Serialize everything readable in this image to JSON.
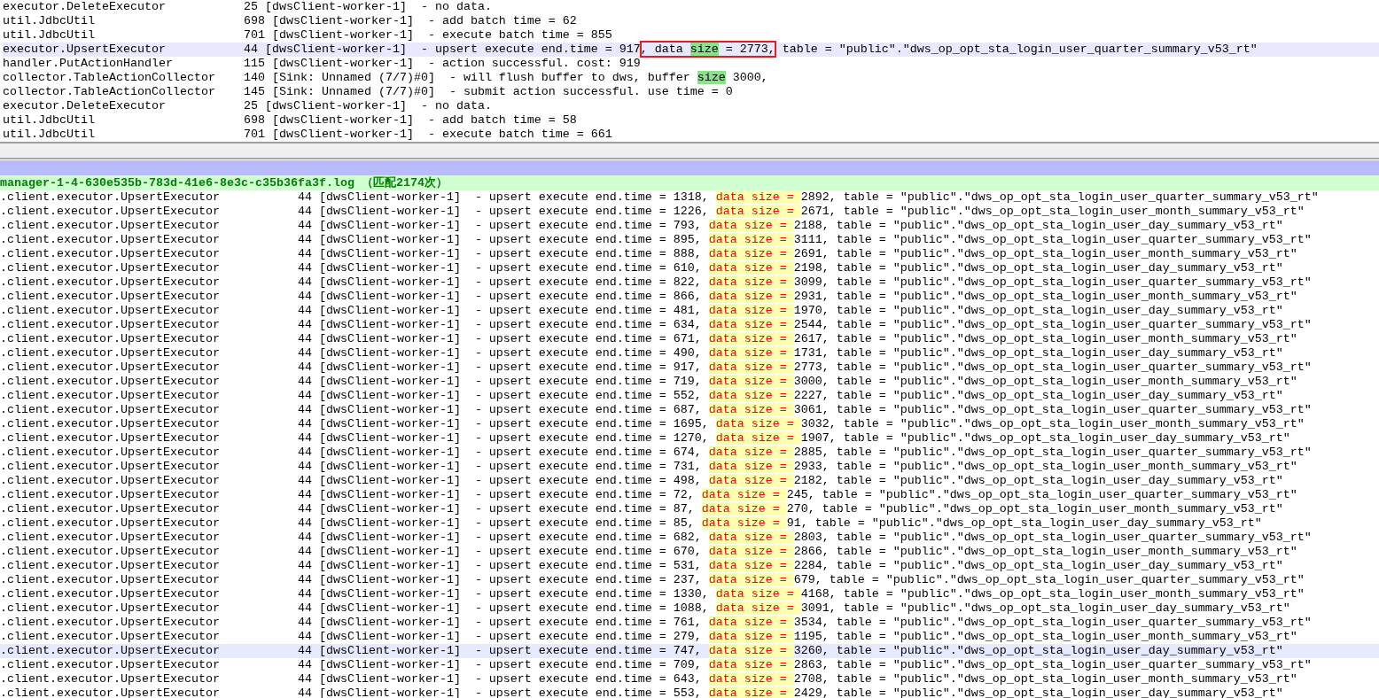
{
  "top_pane": {
    "lines": [
      {
        "current": false,
        "parts": [
          {
            "kind": "plain",
            "boxed": false,
            "text": "executor.DeleteExecutor           25 [dwsClient-worker-1]  - no data."
          }
        ]
      },
      {
        "current": false,
        "parts": [
          {
            "kind": "plain",
            "boxed": false,
            "text": "util.JdbcUtil                     698 [dwsClient-worker-1]  - add batch time = 62"
          }
        ]
      },
      {
        "current": false,
        "parts": [
          {
            "kind": "plain",
            "boxed": false,
            "text": "util.JdbcUtil                     701 [dwsClient-worker-1]  - execute batch time = 855"
          }
        ]
      },
      {
        "current": true,
        "parts": [
          {
            "kind": "plain",
            "boxed": false,
            "text": "executor.UpsertExecutor           44 [dwsClient-worker-1]  - upsert execute end.time = 917"
          },
          {
            "kind": "plain",
            "boxed": true,
            "text": ", data "
          },
          {
            "kind": "match",
            "boxed": true,
            "text": "size"
          },
          {
            "kind": "plain",
            "boxed": true,
            "text": " = 2773,"
          },
          {
            "kind": "plain",
            "boxed": false,
            "text": " table = \"public\".\"dws_op_opt_sta_login_user_quarter_summary_v53_rt\""
          }
        ]
      },
      {
        "current": false,
        "parts": [
          {
            "kind": "plain",
            "boxed": false,
            "text": "handler.PutActionHandler          115 [dwsClient-worker-1]  - action successful. cost: 919"
          }
        ]
      },
      {
        "current": false,
        "parts": [
          {
            "kind": "plain",
            "boxed": false,
            "text": "collector.TableActionCollector    140 [Sink: Unnamed (7/7)#0]  - will flush buffer to dws, buffer "
          },
          {
            "kind": "match",
            "boxed": false,
            "text": "size"
          },
          {
            "kind": "plain",
            "boxed": false,
            "text": " 3000,"
          }
        ]
      },
      {
        "current": false,
        "parts": [
          {
            "kind": "plain",
            "boxed": false,
            "text": "collector.TableActionCollector    145 [Sink: Unnamed (7/7)#0]  - submit action successful. use time = 0"
          }
        ]
      },
      {
        "current": false,
        "parts": [
          {
            "kind": "plain",
            "boxed": false,
            "text": "executor.DeleteExecutor           25 [dwsClient-worker-1]  - no data."
          }
        ]
      },
      {
        "current": false,
        "parts": [
          {
            "kind": "plain",
            "boxed": false,
            "text": "util.JdbcUtil                     698 [dwsClient-worker-1]  - add batch time = 58"
          }
        ]
      },
      {
        "current": false,
        "parts": [
          {
            "kind": "plain",
            "boxed": false,
            "text": "util.JdbcUtil                     701 [dwsClient-worker-1]  - execute batch time = 661"
          }
        ]
      }
    ]
  },
  "search_results": {
    "file_header": "manager-1-4-630e535b-783d-41e6-8e3c-c35b36fa3f.log （匹配2174次）",
    "lines": [
      {
        "current": false,
        "parts": [
          {
            "kind": "plain",
            "text": ".client.executor.UpsertExecutor           44 [dwsClient-worker-1]  - upsert execute end.time = 1318, "
          },
          {
            "kind": "hit",
            "text": "data size = "
          },
          {
            "kind": "plain",
            "text": "2892, table = \"public\".\"dws_op_opt_sta_login_user_quarter_summary_v53_rt\""
          }
        ]
      },
      {
        "current": false,
        "parts": [
          {
            "kind": "plain",
            "text": ".client.executor.UpsertExecutor           44 [dwsClient-worker-1]  - upsert execute end.time = 1226, "
          },
          {
            "kind": "hit",
            "text": "data size = "
          },
          {
            "kind": "plain",
            "text": "2671, table = \"public\".\"dws_op_opt_sta_login_user_month_summary_v53_rt\""
          }
        ]
      },
      {
        "current": false,
        "parts": [
          {
            "kind": "plain",
            "text": ".client.executor.UpsertExecutor           44 [dwsClient-worker-1]  - upsert execute end.time = 793, "
          },
          {
            "kind": "hit",
            "text": "data size = "
          },
          {
            "kind": "plain",
            "text": "2188, table = \"public\".\"dws_op_opt_sta_login_user_day_summary_v53_rt\""
          }
        ]
      },
      {
        "current": false,
        "parts": [
          {
            "kind": "plain",
            "text": ".client.executor.UpsertExecutor           44 [dwsClient-worker-1]  - upsert execute end.time = 895, "
          },
          {
            "kind": "hit",
            "text": "data size = "
          },
          {
            "kind": "plain",
            "text": "3111, table = \"public\".\"dws_op_opt_sta_login_user_quarter_summary_v53_rt\""
          }
        ]
      },
      {
        "current": false,
        "parts": [
          {
            "kind": "plain",
            "text": ".client.executor.UpsertExecutor           44 [dwsClient-worker-1]  - upsert execute end.time = 888, "
          },
          {
            "kind": "hit",
            "text": "data size = "
          },
          {
            "kind": "plain",
            "text": "2691, table = \"public\".\"dws_op_opt_sta_login_user_month_summary_v53_rt\""
          }
        ]
      },
      {
        "current": false,
        "parts": [
          {
            "kind": "plain",
            "text": ".client.executor.UpsertExecutor           44 [dwsClient-worker-1]  - upsert execute end.time = 610, "
          },
          {
            "kind": "hit",
            "text": "data size = "
          },
          {
            "kind": "plain",
            "text": "2198, table = \"public\".\"dws_op_opt_sta_login_user_day_summary_v53_rt\""
          }
        ]
      },
      {
        "current": false,
        "parts": [
          {
            "kind": "plain",
            "text": ".client.executor.UpsertExecutor           44 [dwsClient-worker-1]  - upsert execute end.time = 822, "
          },
          {
            "kind": "hit",
            "text": "data size = "
          },
          {
            "kind": "plain",
            "text": "3099, table = \"public\".\"dws_op_opt_sta_login_user_quarter_summary_v53_rt\""
          }
        ]
      },
      {
        "current": false,
        "parts": [
          {
            "kind": "plain",
            "text": ".client.executor.UpsertExecutor           44 [dwsClient-worker-1]  - upsert execute end.time = 866, "
          },
          {
            "kind": "hit",
            "text": "data size = "
          },
          {
            "kind": "plain",
            "text": "2931, table = \"public\".\"dws_op_opt_sta_login_user_month_summary_v53_rt\""
          }
        ]
      },
      {
        "current": false,
        "parts": [
          {
            "kind": "plain",
            "text": ".client.executor.UpsertExecutor           44 [dwsClient-worker-1]  - upsert execute end.time = 481, "
          },
          {
            "kind": "hit",
            "text": "data size = "
          },
          {
            "kind": "plain",
            "text": "1970, table = \"public\".\"dws_op_opt_sta_login_user_day_summary_v53_rt\""
          }
        ]
      },
      {
        "current": false,
        "parts": [
          {
            "kind": "plain",
            "text": ".client.executor.UpsertExecutor           44 [dwsClient-worker-1]  - upsert execute end.time = 634, "
          },
          {
            "kind": "hit",
            "text": "data size = "
          },
          {
            "kind": "plain",
            "text": "2544, table = \"public\".\"dws_op_opt_sta_login_user_quarter_summary_v53_rt\""
          }
        ]
      },
      {
        "current": false,
        "parts": [
          {
            "kind": "plain",
            "text": ".client.executor.UpsertExecutor           44 [dwsClient-worker-1]  - upsert execute end.time = 671, "
          },
          {
            "kind": "hit",
            "text": "data size = "
          },
          {
            "kind": "plain",
            "text": "2617, table = \"public\".\"dws_op_opt_sta_login_user_month_summary_v53_rt\""
          }
        ]
      },
      {
        "current": false,
        "parts": [
          {
            "kind": "plain",
            "text": ".client.executor.UpsertExecutor           44 [dwsClient-worker-1]  - upsert execute end.time = 490, "
          },
          {
            "kind": "hit",
            "text": "data size = "
          },
          {
            "kind": "plain",
            "text": "1731, table = \"public\".\"dws_op_opt_sta_login_user_day_summary_v53_rt\""
          }
        ]
      },
      {
        "current": false,
        "parts": [
          {
            "kind": "plain",
            "text": ".client.executor.UpsertExecutor           44 [dwsClient-worker-1]  - upsert execute end.time = 917, "
          },
          {
            "kind": "hit",
            "text": "data size = "
          },
          {
            "kind": "plain",
            "text": "2773, table = \"public\".\"dws_op_opt_sta_login_user_quarter_summary_v53_rt\""
          }
        ]
      },
      {
        "current": false,
        "parts": [
          {
            "kind": "plain",
            "text": ".client.executor.UpsertExecutor           44 [dwsClient-worker-1]  - upsert execute end.time = 719, "
          },
          {
            "kind": "hit",
            "text": "data size = "
          },
          {
            "kind": "plain",
            "text": "3000, table = \"public\".\"dws_op_opt_sta_login_user_month_summary_v53_rt\""
          }
        ]
      },
      {
        "current": false,
        "parts": [
          {
            "kind": "plain",
            "text": ".client.executor.UpsertExecutor           44 [dwsClient-worker-1]  - upsert execute end.time = 552, "
          },
          {
            "kind": "hit",
            "text": "data size = "
          },
          {
            "kind": "plain",
            "text": "2227, table = \"public\".\"dws_op_opt_sta_login_user_day_summary_v53_rt\""
          }
        ]
      },
      {
        "current": false,
        "parts": [
          {
            "kind": "plain",
            "text": ".client.executor.UpsertExecutor           44 [dwsClient-worker-1]  - upsert execute end.time = 687, "
          },
          {
            "kind": "hit",
            "text": "data size = "
          },
          {
            "kind": "plain",
            "text": "3061, table = \"public\".\"dws_op_opt_sta_login_user_quarter_summary_v53_rt\""
          }
        ]
      },
      {
        "current": false,
        "parts": [
          {
            "kind": "plain",
            "text": ".client.executor.UpsertExecutor           44 [dwsClient-worker-1]  - upsert execute end.time = 1695, "
          },
          {
            "kind": "hit",
            "text": "data size = "
          },
          {
            "kind": "plain",
            "text": "3032, table = \"public\".\"dws_op_opt_sta_login_user_month_summary_v53_rt\""
          }
        ]
      },
      {
        "current": false,
        "parts": [
          {
            "kind": "plain",
            "text": ".client.executor.UpsertExecutor           44 [dwsClient-worker-1]  - upsert execute end.time = 1270, "
          },
          {
            "kind": "hit",
            "text": "data size = "
          },
          {
            "kind": "plain",
            "text": "1907, table = \"public\".\"dws_op_opt_sta_login_user_day_summary_v53_rt\""
          }
        ]
      },
      {
        "current": false,
        "parts": [
          {
            "kind": "plain",
            "text": ".client.executor.UpsertExecutor           44 [dwsClient-worker-1]  - upsert execute end.time = 674, "
          },
          {
            "kind": "hit",
            "text": "data size = "
          },
          {
            "kind": "plain",
            "text": "2885, table = \"public\".\"dws_op_opt_sta_login_user_quarter_summary_v53_rt\""
          }
        ]
      },
      {
        "current": false,
        "parts": [
          {
            "kind": "plain",
            "text": ".client.executor.UpsertExecutor           44 [dwsClient-worker-1]  - upsert execute end.time = 731, "
          },
          {
            "kind": "hit",
            "text": "data size = "
          },
          {
            "kind": "plain",
            "text": "2933, table = \"public\".\"dws_op_opt_sta_login_user_month_summary_v53_rt\""
          }
        ]
      },
      {
        "current": false,
        "parts": [
          {
            "kind": "plain",
            "text": ".client.executor.UpsertExecutor           44 [dwsClient-worker-1]  - upsert execute end.time = 498, "
          },
          {
            "kind": "hit",
            "text": "data size = "
          },
          {
            "kind": "plain",
            "text": "2182, table = \"public\".\"dws_op_opt_sta_login_user_day_summary_v53_rt\""
          }
        ]
      },
      {
        "current": false,
        "parts": [
          {
            "kind": "plain",
            "text": ".client.executor.UpsertExecutor           44 [dwsClient-worker-1]  - upsert execute end.time = 72, "
          },
          {
            "kind": "hit",
            "text": "data size = "
          },
          {
            "kind": "plain",
            "text": "245, table = \"public\".\"dws_op_opt_sta_login_user_quarter_summary_v53_rt\""
          }
        ]
      },
      {
        "current": false,
        "parts": [
          {
            "kind": "plain",
            "text": ".client.executor.UpsertExecutor           44 [dwsClient-worker-1]  - upsert execute end.time = 87, "
          },
          {
            "kind": "hit",
            "text": "data size = "
          },
          {
            "kind": "plain",
            "text": "270, table = \"public\".\"dws_op_opt_sta_login_user_month_summary_v53_rt\""
          }
        ]
      },
      {
        "current": false,
        "parts": [
          {
            "kind": "plain",
            "text": ".client.executor.UpsertExecutor           44 [dwsClient-worker-1]  - upsert execute end.time = 85, "
          },
          {
            "kind": "hit",
            "text": "data size = "
          },
          {
            "kind": "plain",
            "text": "91, table = \"public\".\"dws_op_opt_sta_login_user_day_summary_v53_rt\""
          }
        ]
      },
      {
        "current": false,
        "parts": [
          {
            "kind": "plain",
            "text": ".client.executor.UpsertExecutor           44 [dwsClient-worker-1]  - upsert execute end.time = 682, "
          },
          {
            "kind": "hit",
            "text": "data size = "
          },
          {
            "kind": "plain",
            "text": "2803, table = \"public\".\"dws_op_opt_sta_login_user_quarter_summary_v53_rt\""
          }
        ]
      },
      {
        "current": false,
        "parts": [
          {
            "kind": "plain",
            "text": ".client.executor.UpsertExecutor           44 [dwsClient-worker-1]  - upsert execute end.time = 670, "
          },
          {
            "kind": "hit",
            "text": "data size = "
          },
          {
            "kind": "plain",
            "text": "2866, table = \"public\".\"dws_op_opt_sta_login_user_month_summary_v53_rt\""
          }
        ]
      },
      {
        "current": false,
        "parts": [
          {
            "kind": "plain",
            "text": ".client.executor.UpsertExecutor           44 [dwsClient-worker-1]  - upsert execute end.time = 531, "
          },
          {
            "kind": "hit",
            "text": "data size = "
          },
          {
            "kind": "plain",
            "text": "2284, table = \"public\".\"dws_op_opt_sta_login_user_day_summary_v53_rt\""
          }
        ]
      },
      {
        "current": false,
        "parts": [
          {
            "kind": "plain",
            "text": ".client.executor.UpsertExecutor           44 [dwsClient-worker-1]  - upsert execute end.time = 237, "
          },
          {
            "kind": "hit",
            "text": "data size = "
          },
          {
            "kind": "plain",
            "text": "679, table = \"public\".\"dws_op_opt_sta_login_user_quarter_summary_v53_rt\""
          }
        ]
      },
      {
        "current": false,
        "parts": [
          {
            "kind": "plain",
            "text": ".client.executor.UpsertExecutor           44 [dwsClient-worker-1]  - upsert execute end.time = 1330, "
          },
          {
            "kind": "hit",
            "text": "data size = "
          },
          {
            "kind": "plain",
            "text": "4168, table = \"public\".\"dws_op_opt_sta_login_user_month_summary_v53_rt\""
          }
        ]
      },
      {
        "current": false,
        "parts": [
          {
            "kind": "plain",
            "text": ".client.executor.UpsertExecutor           44 [dwsClient-worker-1]  - upsert execute end.time = 1088, "
          },
          {
            "kind": "hit",
            "text": "data size = "
          },
          {
            "kind": "plain",
            "text": "3091, table = \"public\".\"dws_op_opt_sta_login_user_day_summary_v53_rt\""
          }
        ]
      },
      {
        "current": false,
        "parts": [
          {
            "kind": "plain",
            "text": ".client.executor.UpsertExecutor           44 [dwsClient-worker-1]  - upsert execute end.time = 761, "
          },
          {
            "kind": "hit",
            "text": "data size = "
          },
          {
            "kind": "plain",
            "text": "3534, table = \"public\".\"dws_op_opt_sta_login_user_quarter_summary_v53_rt\""
          }
        ]
      },
      {
        "current": false,
        "parts": [
          {
            "kind": "plain",
            "text": ".client.executor.UpsertExecutor           44 [dwsClient-worker-1]  - upsert execute end.time = 279, "
          },
          {
            "kind": "hit",
            "text": "data size = "
          },
          {
            "kind": "plain",
            "text": "1195, table = \"public\".\"dws_op_opt_sta_login_user_month_summary_v53_rt\""
          }
        ]
      },
      {
        "current": true,
        "parts": [
          {
            "kind": "plain",
            "text": ".client.executor.UpsertExecutor           44 [dwsClient-worker-1]  - upsert execute end.time = 747, "
          },
          {
            "kind": "hit",
            "text": "data size = "
          },
          {
            "kind": "plain",
            "text": "3260, table = \"public\".\"dws_op_opt_sta_login_user_day_summary_v53_rt\""
          }
        ]
      },
      {
        "current": false,
        "parts": [
          {
            "kind": "plain",
            "text": ".client.executor.UpsertExecutor           44 [dwsClient-worker-1]  - upsert execute end.time = 709, "
          },
          {
            "kind": "hit",
            "text": "data size = "
          },
          {
            "kind": "plain",
            "text": "2863, table = \"public\".\"dws_op_opt_sta_login_user_quarter_summary_v53_rt\""
          }
        ]
      },
      {
        "current": false,
        "parts": [
          {
            "kind": "plain",
            "text": ".client.executor.UpsertExecutor           44 [dwsClient-worker-1]  - upsert execute end.time = 643, "
          },
          {
            "kind": "hit",
            "text": "data size = "
          },
          {
            "kind": "plain",
            "text": "2708, table = \"public\".\"dws_op_opt_sta_login_user_month_summary_v53_rt\""
          }
        ]
      },
      {
        "current": false,
        "parts": [
          {
            "kind": "plain",
            "text": ".client.executor.UpsertExecutor           44 [dwsClient-worker-1]  - upsert execute end.time = 553, "
          },
          {
            "kind": "hit",
            "text": "data size = "
          },
          {
            "kind": "plain",
            "text": "2429, table = \"public\".\"dws_op_opt_sta_login_user_day_summary_v53_rt\""
          }
        ]
      }
    ]
  }
}
